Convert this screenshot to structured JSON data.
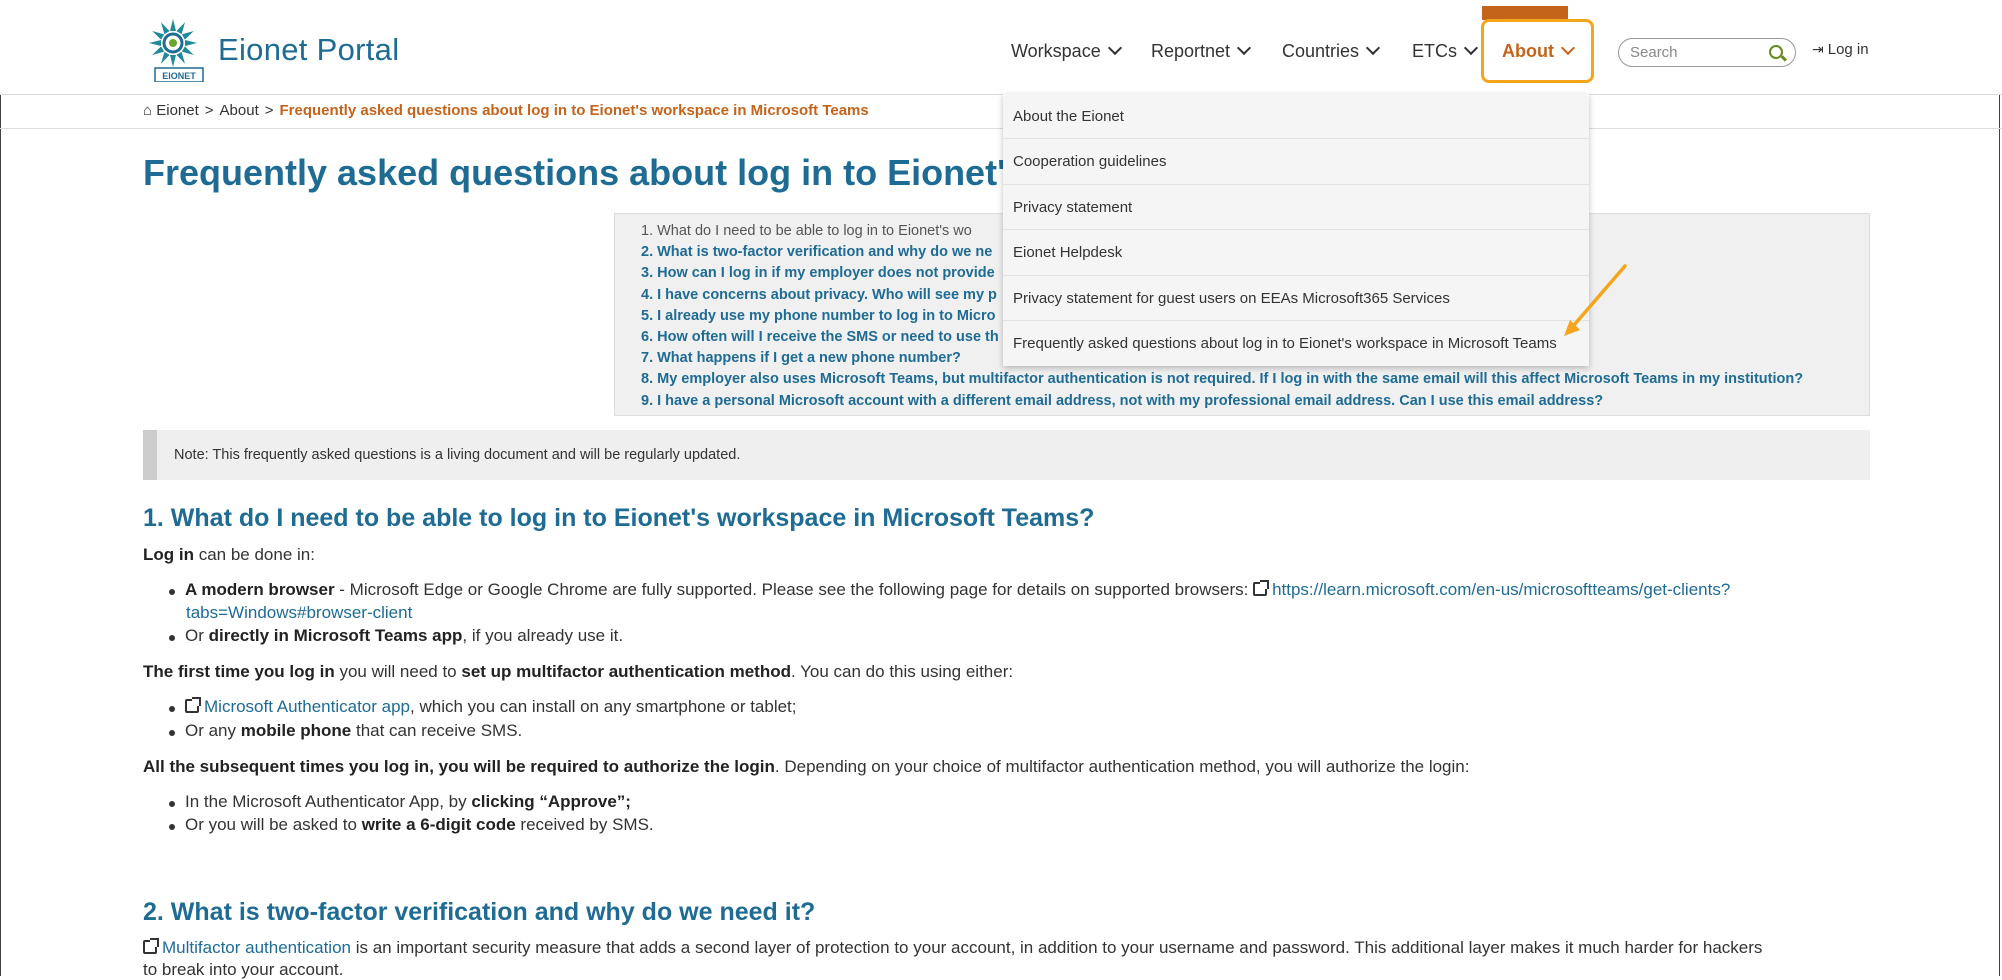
{
  "header": {
    "brand": "Eionet Portal",
    "logo_text": "EIONET",
    "nav": [
      {
        "label": "Workspace"
      },
      {
        "label": "Reportnet"
      },
      {
        "label": "Countries"
      },
      {
        "label": "ETCs"
      },
      {
        "label": "About"
      }
    ],
    "search_placeholder": "Search",
    "login_label": "Log in"
  },
  "breadcrumb": {
    "items": [
      "Eionet",
      "About",
      "Frequently asked questions about log in to Eionet's workspace in Microsoft Teams"
    ]
  },
  "page_title": "Frequently asked questions about log in to Eionet's w",
  "toc": [
    "1. What do I need to be able to log in to Eionet's wo",
    "2. What is two-factor verification and why do we ne",
    "3. How can I log in if my employer does not provide",
    "4. I have concerns about privacy. Who will see my p",
    "5. I already use my phone number to log in to Micro",
    "6. How often will I receive the SMS or need to use th",
    "7. What happens if I get a new phone number?",
    "8. My employer also uses Microsoft Teams, but multifactor authentication is not required. If I log in with the same email will this affect Microsoft Teams in my institution?",
    "9. I have a personal Microsoft account with a different email address, not with my professional email address. Can I use this email address?"
  ],
  "note": "Note: This frequently asked questions is a living document and will be regularly updated.",
  "section1": {
    "heading": "1. What do I need to be able to log in to Eionet's workspace in Microsoft Teams?",
    "login_bold": "Log in",
    "login_rest": " can be done in:",
    "b1_bold": "A modern browser",
    "b1_rest": " - Microsoft Edge or Google Chrome are fully supported. Please see the following page for details on supported browsers: ",
    "b1_link": "https://learn.microsoft.com/en-us/microsoftteams/get-clients?",
    "b1_link2": "tabs=Windows#browser-client",
    "b2_pre": "Or ",
    "b2_bold": "directly in Microsoft Teams app",
    "b2_rest": ", if you already use it.",
    "first_bold": "The first time you log in",
    "first_mid": " you will need to ",
    "first_bold2": "set up multifactor authentication method",
    "first_rest": ". You can do this using either:",
    "c1_link": "Microsoft Authenticator app",
    "c1_rest": ", which you can install on any smartphone or tablet;",
    "c2_pre": "Or any ",
    "c2_bold": "mobile phone",
    "c2_rest": " that can receive SMS.",
    "sub_bold": "All the subsequent times you log in, you will be required to authorize the login",
    "sub_rest": ". Depending on your choice of multifactor authentication method, you will authorize the login:",
    "d1_pre": "In the Microsoft Authenticator App, by ",
    "d1_bold": "clicking “Approve”;",
    "d2_pre": "Or you will be asked to ",
    "d2_bold": "write a 6-digit code",
    "d2_rest": " received by SMS."
  },
  "section2": {
    "heading": "2. What is two-factor verification and why do we need it?",
    "link": "Multifactor authentication",
    "rest": " is an important security measure that adds a second layer of protection to your account, in addition to your username and password. This additional layer makes it much harder for hackers",
    "rest2": "to break into your account."
  },
  "dropdown": [
    "About the Eionet",
    "Cooperation guidelines",
    "Privacy statement",
    "Eionet Helpdesk",
    "Privacy statement for guest users on EEAs Microsoft365 Services",
    "Frequently asked questions about log in to Eionet's workspace in Microsoft Teams"
  ],
  "colors": {
    "brand": "#1e6b94",
    "accent": "#f4a51c",
    "active": "#c4641b"
  }
}
